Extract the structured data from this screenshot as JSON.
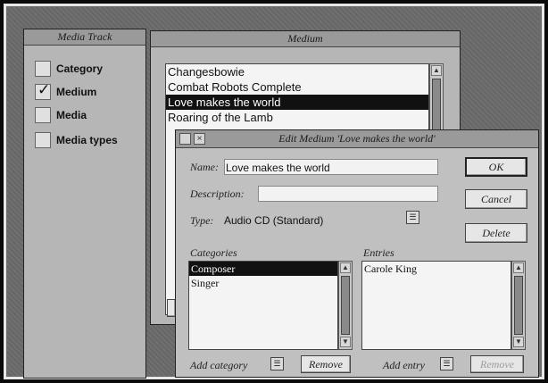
{
  "media_track": {
    "title": "Media Track",
    "items": [
      {
        "label": "Category",
        "checked": false
      },
      {
        "label": "Medium",
        "checked": true
      },
      {
        "label": "Media",
        "checked": false
      },
      {
        "label": "Media types",
        "checked": false
      }
    ]
  },
  "medium_window": {
    "title": "Medium",
    "items": [
      "Changesbowie",
      "Combat Robots Complete",
      "Love makes the world",
      "Roaring of the Lamb"
    ],
    "selected_index": 2
  },
  "edit_dialog": {
    "title": "Edit Medium 'Love makes the world'",
    "name_label": "Name:",
    "name_value": "Love makes the world",
    "description_label": "Description:",
    "description_value": "",
    "type_label": "Type:",
    "type_value": "Audio CD (Standard)",
    "ok_label": "OK",
    "cancel_label": "Cancel",
    "delete_label": "Delete",
    "categories_label": "Categories",
    "categories": [
      "Composer",
      "Singer"
    ],
    "categories_selected_index": 0,
    "entries_label": "Entries",
    "entries": [
      "Carole King"
    ],
    "add_category_label": "Add category",
    "remove_category_label": "Remove",
    "add_entry_label": "Add entry",
    "remove_entry_label": "Remove"
  },
  "icons": {
    "popup": "popup-menu-icon",
    "scroll_up": "▲",
    "scroll_down": "▼",
    "close": "×"
  }
}
